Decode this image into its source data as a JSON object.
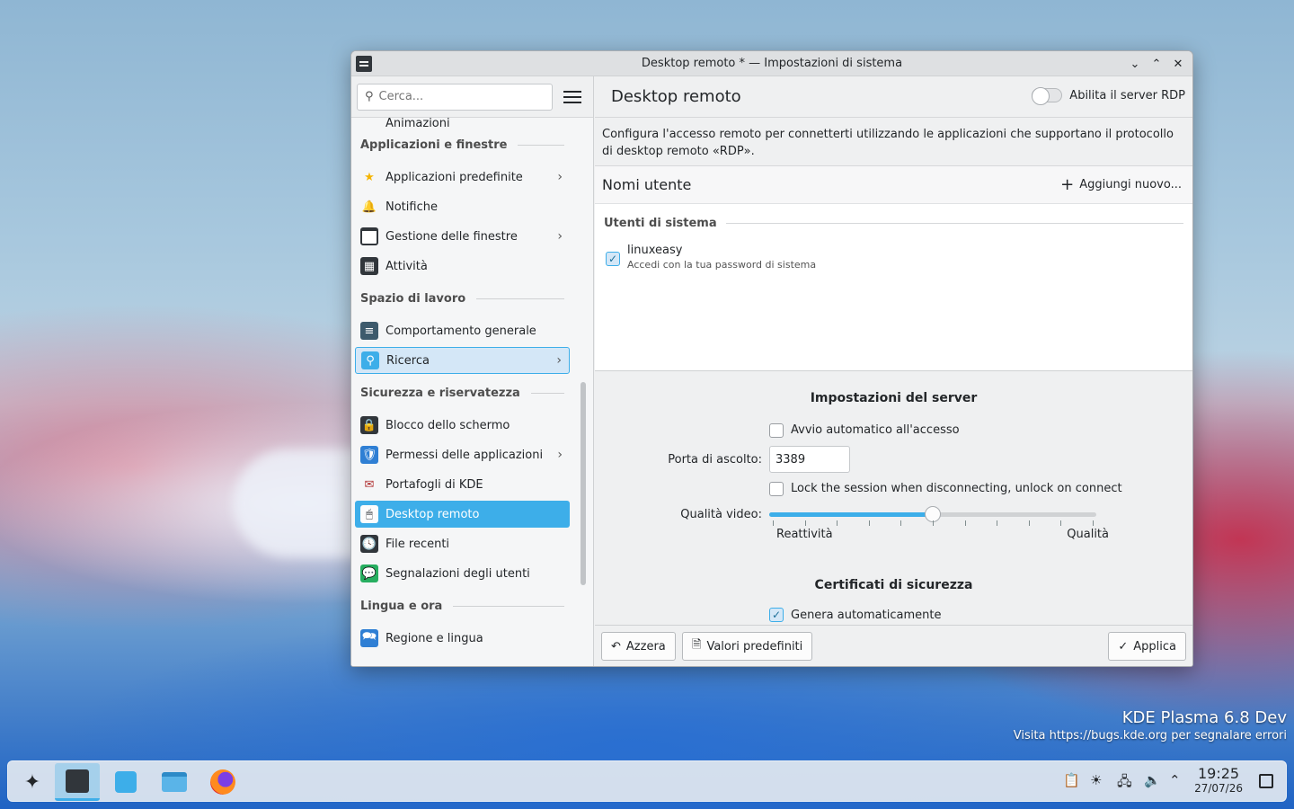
{
  "window": {
    "title": "Desktop remoto * — Impostazioni di sistema"
  },
  "sidebar": {
    "search_placeholder": "Cerca...",
    "partial_item": "Animazioni",
    "sections": [
      {
        "title": "Applicazioni e finestre",
        "items": [
          {
            "label": "Applicazioni predefinite",
            "icon": "star-icon",
            "chevron": true
          },
          {
            "label": "Notifiche",
            "icon": "bell-icon",
            "chevron": false
          },
          {
            "label": "Gestione delle finestre",
            "icon": "window-icon",
            "chevron": true
          },
          {
            "label": "Attività",
            "icon": "activities-icon",
            "chevron": false
          }
        ]
      },
      {
        "title": "Spazio di lavoro",
        "items": [
          {
            "label": "Comportamento generale",
            "icon": "workspace-icon",
            "chevron": false
          },
          {
            "label": "Ricerca",
            "icon": "search-icon",
            "chevron": true
          }
        ]
      },
      {
        "title": "Sicurezza e riservatezza",
        "items": [
          {
            "label": "Blocco dello schermo",
            "icon": "lock-screen-icon",
            "chevron": false
          },
          {
            "label": "Permessi delle applicazioni",
            "icon": "shield-icon",
            "chevron": true
          },
          {
            "label": "Portafogli di KDE",
            "icon": "wallet-icon",
            "chevron": false
          },
          {
            "label": "Desktop remoto",
            "icon": "remote-desktop-icon",
            "chevron": false
          },
          {
            "label": "File recenti",
            "icon": "clock-icon",
            "chevron": false
          },
          {
            "label": "Segnalazioni degli utenti",
            "icon": "feedback-icon",
            "chevron": false
          }
        ]
      },
      {
        "title": "Lingua e ora",
        "items": [
          {
            "label": "Regione e lingua",
            "icon": "region-icon",
            "chevron": false
          }
        ]
      }
    ],
    "hovered": "Ricerca",
    "selected": "Desktop remoto"
  },
  "main": {
    "title": "Desktop remoto",
    "rdp_toggle_label": "Abilita il server RDP",
    "rdp_enabled": false,
    "description": "Configura l'accesso remoto per connetterti utilizzando le applicazioni che supportano il protocollo di desktop remoto «RDP».",
    "users": {
      "heading": "Nomi utente",
      "add_label": "Aggiungi nuovo...",
      "group_title": "Utenti di sistema",
      "list": [
        {
          "name": "linuxeasy",
          "hint": "Accedi con la tua password di sistema",
          "checked": true
        }
      ]
    },
    "server": {
      "title": "Impostazioni del server",
      "autostart_label": "Avvio automatico all'accesso",
      "autostart_checked": false,
      "port_label": "Porta di ascolto:",
      "port_value": "3389",
      "lock_label": "Lock the session when disconnecting, unlock on connect",
      "lock_checked": false,
      "quality_label": "Qualità video:",
      "quality_min_label": "Reattività",
      "quality_max_label": "Qualità",
      "quality_value": 0.5,
      "quality_ticks": 11
    },
    "certs": {
      "title": "Certificati di sicurezza",
      "autogen_label": "Genera automaticamente",
      "autogen_checked": true
    }
  },
  "footer": {
    "reset_label": "Azzera",
    "defaults_label": "Valori predefiniti",
    "apply_label": "Applica"
  },
  "watermark": {
    "line1": "KDE Plasma 6.8 Dev",
    "line2": "Visita https://bugs.kde.org per segnalare errori"
  },
  "taskbar": {
    "time": "19:25",
    "date": "27/07/26"
  }
}
